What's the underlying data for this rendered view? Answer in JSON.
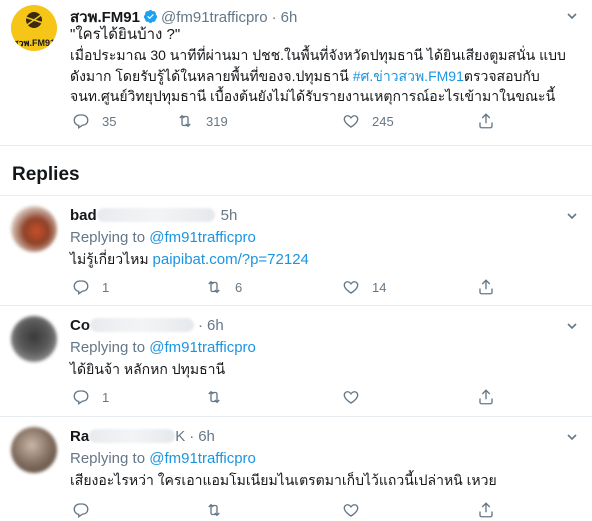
{
  "main_tweet": {
    "author_name": "สวพ.FM91",
    "handle": "@fm91trafficpro",
    "dot": "·",
    "time": "6h",
    "avatar_text": "สวพ.FM91",
    "text_line1": "\"ใครได้ยินบ้าง ?\"",
    "text_line2": "เมื่อประมาณ 30 นาทีที่ผ่านมา ปชช.ในพื้นที่จังหวัดปทุมธานี ได้ยินเสียงตูมสนั่น  แบบ",
    "text_line3_plain": "ดังมาก  โดยรับรู้ได้ในหลายพื้นที่ของจ.ปทุมธานี   ",
    "hashtag": "#ศ.ข่าวสวพ.FM91",
    "text_line3_tail": "ตรวจสอบกับ",
    "text_line4": "จนท.ศูนย์วิทยุปทุมธานี เบื้องต้นยังไม่ได้รับรายงานเหตุการณ์อะไรเข้ามาในขณะนี้",
    "replies_count": "35",
    "retweets_count": "319",
    "likes_count": "245"
  },
  "replies_section": {
    "title": "Replies"
  },
  "replies": [
    {
      "name_visible": "bad",
      "time": "5h",
      "replying_prefix": "Replying to ",
      "replying_handle": "@fm91trafficpro",
      "text": "ไม่รู้เกี่ยวไหม ",
      "link": "paipibat.com/?p=72124",
      "replies_count": "1",
      "retweets_count": "6",
      "likes_count": "14"
    },
    {
      "name_visible": "Co",
      "time": "6h",
      "replying_prefix": "Replying to ",
      "replying_handle": "@fm91trafficpro",
      "text": "ได้ยินจ้า หลักหก ปทุมธานี",
      "replies_count": "1",
      "retweets_count": "",
      "likes_count": ""
    },
    {
      "name_visible": "Ra",
      "name_tail": "K",
      "time": "6h",
      "replying_prefix": "Replying to ",
      "replying_handle": "@fm91trafficpro",
      "text": "เสียงอะไรหว่า ใครเอาแอมโมเนียมไนเตรตมาเก็บไว้แถวนี้เปล่าหนิ เหวย"
    }
  ],
  "colors": {
    "link": "#1b95e0",
    "secondary": "#657786",
    "border": "#e6ecf0",
    "logo_yellow": "#f5c518"
  },
  "icons": [
    "verified-badge-icon",
    "chevron-down-icon",
    "reply-icon",
    "retweet-icon",
    "like-icon",
    "share-icon"
  ]
}
